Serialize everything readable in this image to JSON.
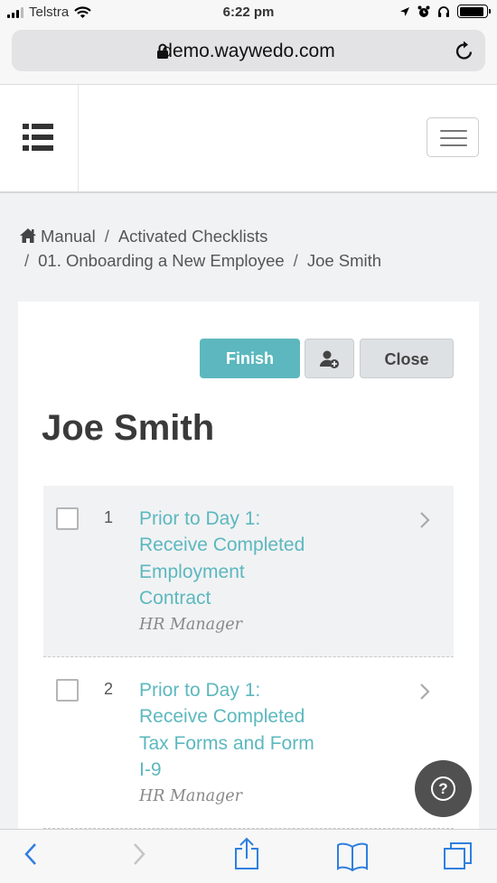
{
  "status_bar": {
    "carrier": "Telstra",
    "time": "6:22 pm",
    "battery_level": 0.9,
    "icons": [
      "signal-icon",
      "wifi-icon",
      "location-arrow-icon",
      "alarm-icon",
      "headphones-icon",
      "battery-icon"
    ]
  },
  "browser": {
    "url": "demo.waywedo.com",
    "icons": [
      "lock-icon",
      "reload-icon"
    ]
  },
  "app_header": {
    "icons": [
      "checklist-icon",
      "hamburger-menu-icon"
    ]
  },
  "breadcrumb": {
    "items": [
      "Manual",
      "Activated Checklists",
      "01. Onboarding a New Employee",
      "Joe Smith"
    ],
    "separator": "/"
  },
  "actions": {
    "finish_label": "Finish",
    "assign_icon": "add-user-icon",
    "close_label": "Close"
  },
  "checklist": {
    "title": "Joe Smith",
    "items": [
      {
        "number": "1",
        "line1": "Prior to Day 1:",
        "line2": "Receive Completed",
        "line3": "Employment",
        "line4": "Contract",
        "role": "HR Manager"
      },
      {
        "number": "2",
        "line1": "Prior to Day 1:",
        "line2": "Receive Completed",
        "line3": "Tax Forms and Form",
        "line4": "I-9",
        "role": "HR Manager"
      }
    ]
  },
  "help": {
    "label": "?"
  },
  "colors": {
    "accent": "#5cb8be",
    "page_background": "#f1f2f4",
    "help_button": "#505050"
  },
  "toolbar": {
    "icons": [
      "back-icon",
      "forward-icon",
      "share-icon",
      "bookmarks-icon",
      "tabs-icon"
    ]
  }
}
